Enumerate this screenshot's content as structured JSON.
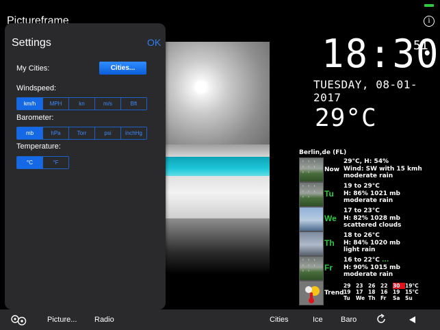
{
  "app": {
    "title": "Pictureframe",
    "info_icon": "i"
  },
  "clock": {
    "time": "18:30",
    "seconds": "51",
    "date": "TUESDAY, 08-01-2017",
    "temperature": "29°C"
  },
  "forecast": {
    "location": "Berlin,de (FL)",
    "rows": [
      {
        "label": "Now",
        "line1": "29°C, H: 54%",
        "line2": "Wind: SW with 15 kmh",
        "line3": "moderate rain",
        "icon": "rain-icon"
      },
      {
        "label": "Tu",
        "line1": "19 to 29°C",
        "line2": "H: 86% 1021 mb",
        "line3": "moderate rain",
        "icon": "rain-icon"
      },
      {
        "label": "We",
        "line1": "17 to 23°C",
        "line2": "H: 82% 1028 mb",
        "line3": "scattered clouds",
        "icon": "cloud-icon"
      },
      {
        "label": "Th",
        "line1": "18 to 26°C",
        "line2": "H: 84% 1020 mb",
        "line3": "light rain",
        "icon": "light-rain-icon"
      },
      {
        "label": "Fr",
        "line1": "16 to 22°C",
        "line1_extra": "...",
        "line2": "H: 90% 1015 mb",
        "line3": "moderate rain",
        "icon": "rain-icon"
      }
    ],
    "trend": {
      "label": "Trend",
      "highs": [
        "29",
        "23",
        "26",
        "22",
        "30",
        "19°C"
      ],
      "lows": [
        "19",
        "17",
        "18",
        "16",
        "19",
        "15°C"
      ],
      "days": [
        "Tu",
        "We",
        "Th",
        "Fr",
        "Sa",
        "Su"
      ],
      "highlight_color": "#e0121b"
    }
  },
  "settings": {
    "title": "Settings",
    "ok_label": "OK",
    "my_cities_label": "My Cities:",
    "cities_button": "Cities...",
    "windspeed_label": "Windspeed:",
    "windspeed_options": [
      "km/h",
      "MPH",
      "kn",
      "m/s",
      "Bft"
    ],
    "windspeed_selected": "km/h",
    "barometer_label": "Barometer:",
    "barometer_options": [
      "mb",
      "hPa",
      "Torr",
      "psi",
      "inchHg"
    ],
    "barometer_selected": "mb",
    "temperature_label": "Temperature:",
    "temperature_options": [
      "°C",
      "°F"
    ],
    "temperature_selected": "°C",
    "accent_color": "#1569e6"
  },
  "toolbar": {
    "picture": "Picture...",
    "radio": "Radio",
    "cities": "Cities",
    "ice": "Ice",
    "baro": "Baro"
  },
  "colors": {
    "green": "#2ecc40",
    "link_blue": "#2f80ed"
  }
}
